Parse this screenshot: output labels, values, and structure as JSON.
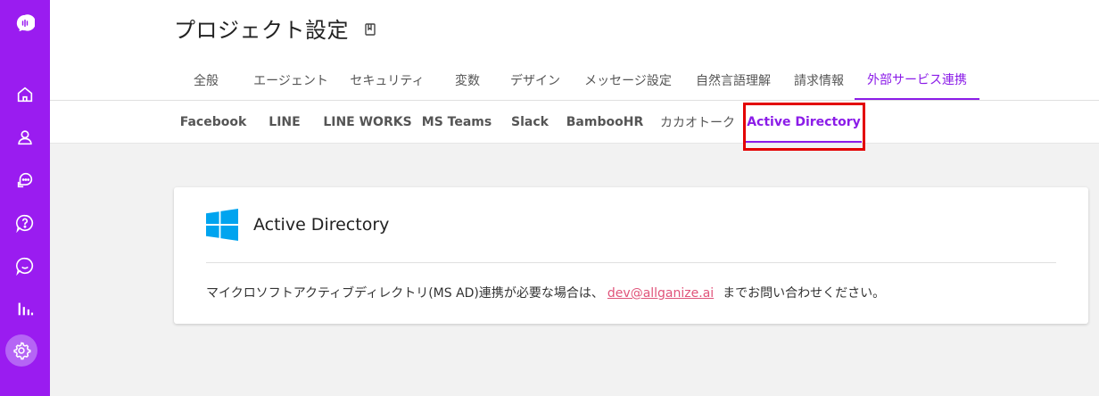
{
  "colors": {
    "sidebar": "#9a1cf0",
    "accent": "#8b1ce8",
    "highlight": "#e30000",
    "link": "#e0537a",
    "windows_blue": "#00a4ef"
  },
  "sidebar": {
    "icons": [
      "logo-icon",
      "home-icon",
      "user-icon",
      "chat-bubbles-icon",
      "faq-icon",
      "conversation-icon",
      "stats-icon",
      "settings-icon"
    ]
  },
  "header": {
    "title": "プロジェクト設定",
    "title_icon": "book-icon"
  },
  "main_tabs": [
    {
      "label": "全般"
    },
    {
      "label": "エージェント"
    },
    {
      "label": "セキュリティ"
    },
    {
      "label": "変数"
    },
    {
      "label": "デザイン"
    },
    {
      "label": "メッセージ設定"
    },
    {
      "label": "自然言語理解"
    },
    {
      "label": "請求情報"
    },
    {
      "label": "外部サービス連携",
      "active": true
    }
  ],
  "sub_tabs": [
    {
      "label": "Facebook"
    },
    {
      "label": "LINE"
    },
    {
      "label": "LINE WORKS"
    },
    {
      "label": "MS Teams"
    },
    {
      "label": "Slack"
    },
    {
      "label": "BambooHR"
    },
    {
      "label": "カカオトーク"
    },
    {
      "label": "Active Directory",
      "active": true
    }
  ],
  "card": {
    "icon": "windows-icon",
    "title": "Active Directory",
    "text_before": "マイクロソフトアクティブディレクトリ(MS AD)連携が必要な場合は、",
    "email": "dev@allganize.ai",
    "text_after": "までお問い合わせください。"
  }
}
